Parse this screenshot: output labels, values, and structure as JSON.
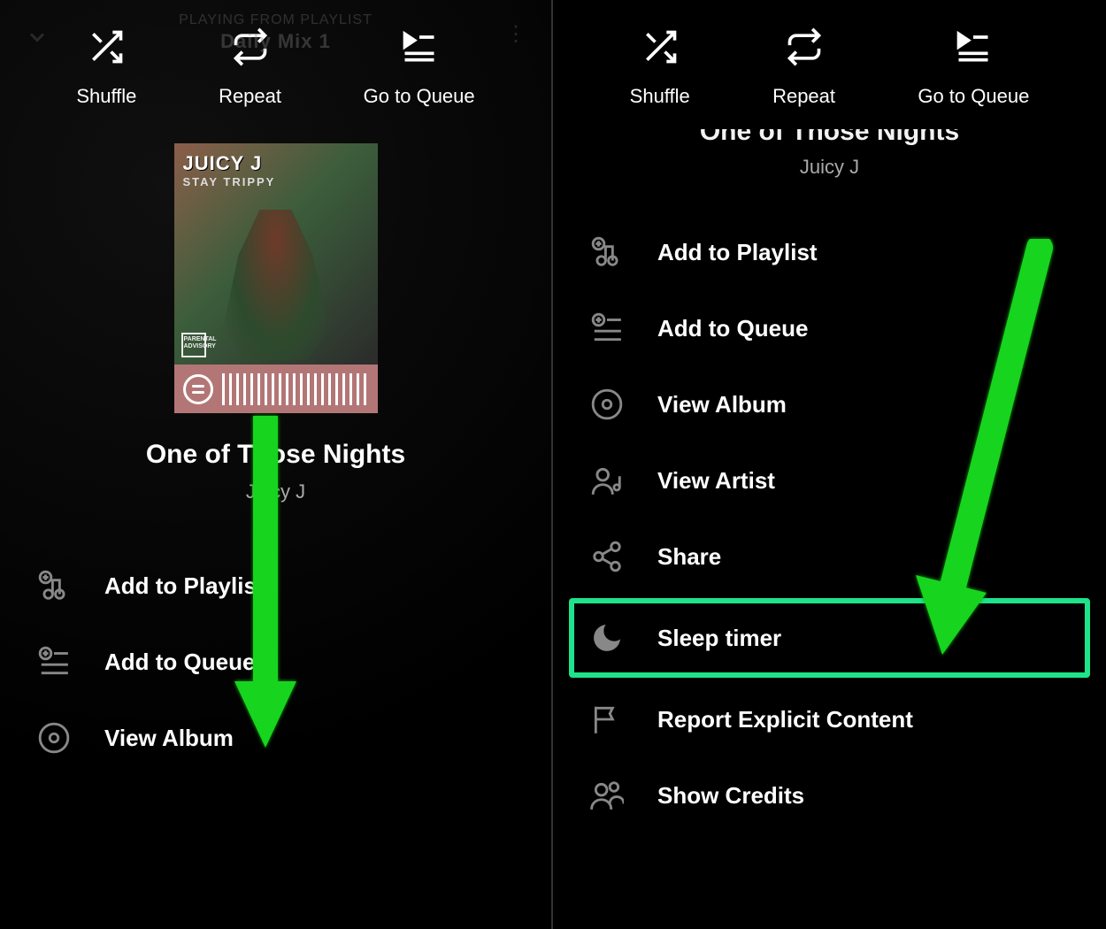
{
  "left": {
    "context_line1": "PLAYING FROM PLAYLIST",
    "context_line2": "Daily Mix 1",
    "toolbar": {
      "shuffle": "Shuffle",
      "repeat": "Repeat",
      "queue": "Go to Queue"
    },
    "album": {
      "logo": "JUICY J",
      "sub": "STAY TRIPPY",
      "pa": "PARENTAL ADVISORY"
    },
    "track_title": "One of Those Nights",
    "artist": "Juicy J",
    "menu": {
      "add_playlist": "Add to Playlist",
      "add_queue": "Add to Queue",
      "view_album": "View Album"
    }
  },
  "right": {
    "toolbar": {
      "shuffle": "Shuffle",
      "repeat": "Repeat",
      "queue": "Go to Queue"
    },
    "track_title": "One of Those Nights",
    "artist": "Juicy J",
    "menu": {
      "add_playlist": "Add to Playlist",
      "add_queue": "Add to Queue",
      "view_album": "View Album",
      "view_artist": "View Artist",
      "share": "Share",
      "sleep_timer": "Sleep timer",
      "report": "Report Explicit Content",
      "credits": "Show Credits"
    }
  },
  "colors": {
    "highlight": "#1ee38a"
  }
}
